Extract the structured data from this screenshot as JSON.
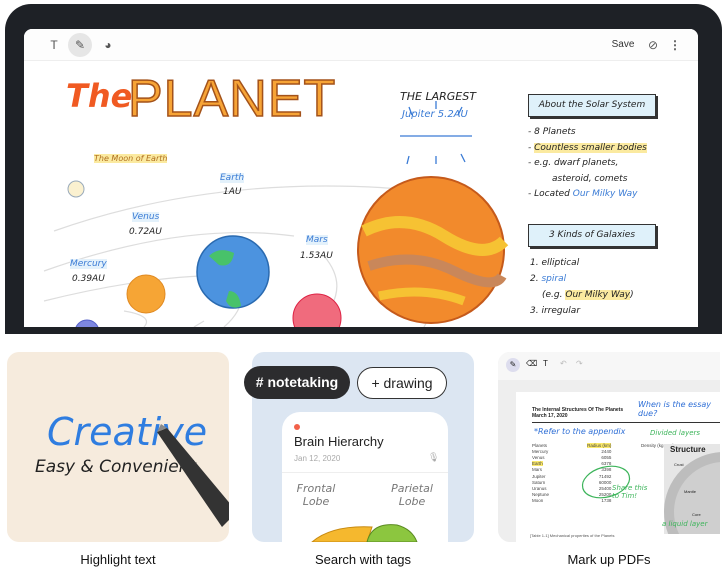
{
  "toolbar": {
    "save_label": "Save",
    "icons": [
      "text-icon",
      "pen-icon",
      "palette-icon",
      "attach-icon",
      "more-icon"
    ]
  },
  "note": {
    "title_the": "The",
    "title_planet": "PLANET",
    "largest_label": "THE LARGEST",
    "largest_value": "Jupiter 5.2AU",
    "moon_label": "The Moon of Earth",
    "planets": [
      {
        "name": "Earth",
        "distance": "1AU"
      },
      {
        "name": "Venus",
        "distance": "0.72AU"
      },
      {
        "name": "Mars",
        "distance": "1.53AU"
      },
      {
        "name": "Mercury",
        "distance": "0.39AU"
      }
    ],
    "solar_heading": "About the Solar System",
    "solar_items": [
      {
        "prefix": "- ",
        "text": "8 Planets"
      },
      {
        "prefix": "- ",
        "text": "Countless smaller bodies"
      },
      {
        "prefix": "- ",
        "text": "e.g. dwarf planets,"
      },
      {
        "prefix": "",
        "text": "asteroid, comets"
      },
      {
        "prefix": "- Located ",
        "text": "Our Milky Way"
      }
    ],
    "galaxy_heading": "3 Kinds of Galaxies",
    "galaxy_items": [
      "1. elliptical",
      "2.",
      "spiral",
      "(e.g.",
      "Our Milky Way",
      ")",
      "3. irregular"
    ]
  },
  "features": [
    {
      "caption": "Highlight text",
      "word1": "Creative",
      "word2": "Easy & Convenient"
    },
    {
      "caption": "Search with tags",
      "tag_active": "# notetaking",
      "tag_add": "+ drawing",
      "note_title": "Brain Hierarchy",
      "note_date": "Jan 12, 2020",
      "label_left": "Frontal Lobe",
      "label_right": "Parietal Lobe"
    },
    {
      "caption": "Mark up PDFs",
      "doc_title": "The Internal Structures Of The Planets",
      "doc_date": "March 17, 2020",
      "note_top": "When is the essay due?",
      "note_refer": "*Refer to the appendix",
      "note_layers": "Divided layers",
      "note_share": "Share this to Tim!",
      "note_liquid": "a liquid layer",
      "columns": [
        "Planets",
        "Radius (km)",
        "Density (kg m-3)"
      ],
      "rows": [
        [
          "Mercury",
          "2440",
          "5400"
        ],
        [
          "Venus",
          "6055",
          "5266"
        ],
        [
          "Earth",
          "6378",
          "5517"
        ],
        [
          "Mars",
          "3398",
          "3937"
        ],
        [
          "Jupiter",
          "71492",
          "1560"
        ],
        [
          "Saturn",
          "60000",
          "700"
        ],
        [
          "Uranus",
          "25400",
          "1530"
        ],
        [
          "Neptune",
          "25200",
          "1570"
        ],
        [
          "Moon",
          "1738",
          "3340"
        ]
      ],
      "table_caption": "[Table 1-1] Mechanical properties of the Planets",
      "diagram_title": "Structure",
      "diagram_labels": [
        "Crust",
        "Mantle",
        "Core"
      ]
    }
  ]
}
